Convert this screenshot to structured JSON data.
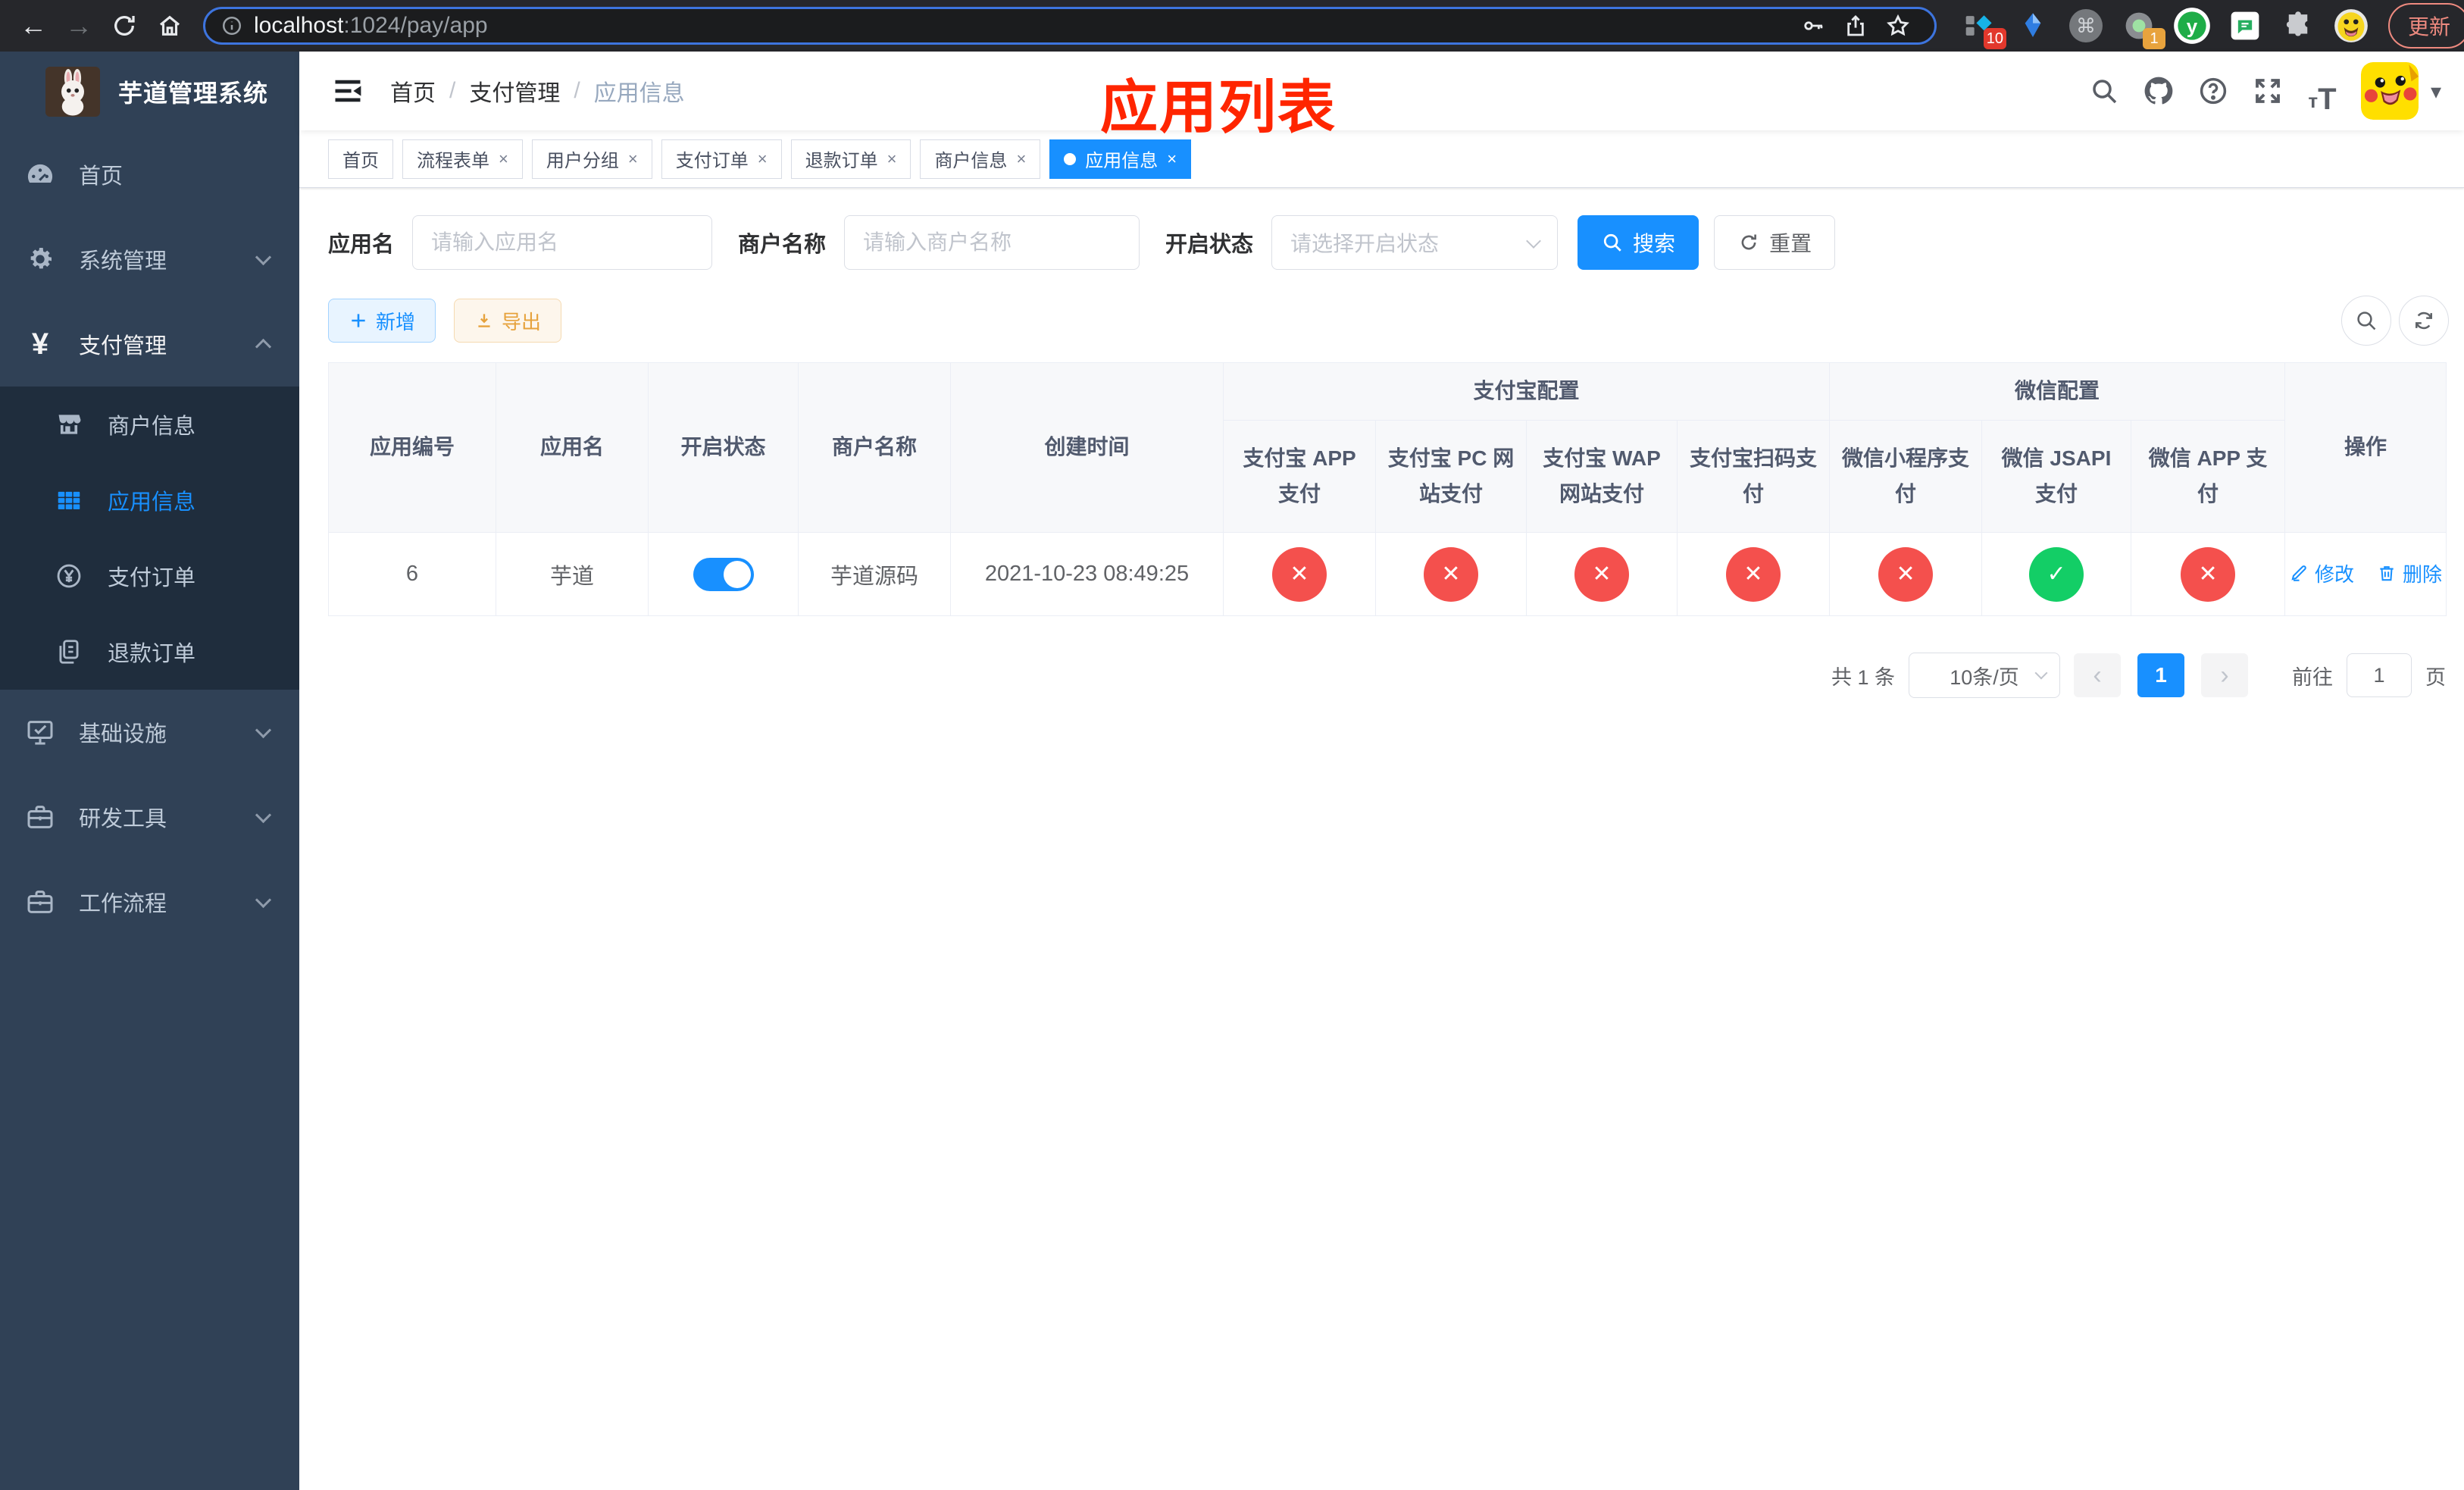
{
  "glyphs": {
    "back": "←",
    "forward": "→",
    "close": "×",
    "check": "✓",
    "cross": "✕",
    "dot": "",
    "caret": "▾",
    "kebab": "⋮",
    "cmd": "⌘",
    "prev": "‹",
    "next": "›",
    "plus": "＋",
    "ext_y": "y"
  },
  "colors": {
    "primary": "#1890ff",
    "danger": "#f4504d",
    "success": "#13ce66",
    "warning": "#e6a23c",
    "annotation_red": "#ff2500",
    "sidebar_bg": "#304156",
    "submenu_bg": "#1f2d3d"
  },
  "browser": {
    "url_host": "localhost",
    "url_rest": ":1024/pay/app",
    "ext_badge_pinned": "10",
    "ext_badge_recorder": "1",
    "update_label": "更新"
  },
  "sidebar": {
    "title": "芋道管理系统",
    "items": [
      {
        "label": "首页"
      },
      {
        "label": "系统管理"
      },
      {
        "label": "支付管理"
      },
      {
        "label": "基础设施"
      },
      {
        "label": "研发工具"
      },
      {
        "label": "工作流程"
      }
    ],
    "subitems": [
      {
        "label": "商户信息"
      },
      {
        "label": "应用信息"
      },
      {
        "label": "支付订单"
      },
      {
        "label": "退款订单"
      }
    ]
  },
  "header": {
    "breadcrumb": [
      "首页",
      "支付管理",
      "应用信息"
    ],
    "annotation": "应用列表"
  },
  "tabs": [
    {
      "label": "首页"
    },
    {
      "label": "流程表单"
    },
    {
      "label": "用户分组"
    },
    {
      "label": "支付订单"
    },
    {
      "label": "退款订单"
    },
    {
      "label": "商户信息"
    },
    {
      "label": "应用信息"
    }
  ],
  "filters": {
    "app_name_label": "应用名",
    "app_name_placeholder": "请输入应用名",
    "merchant_label": "商户名称",
    "merchant_placeholder": "请输入商户名称",
    "status_label": "开启状态",
    "status_placeholder": "请选择开启状态",
    "search_label": "搜索",
    "reset_label": "重置"
  },
  "toolbar": {
    "add_label": "新增",
    "export_label": "导出"
  },
  "table": {
    "headers_main": [
      "应用编号",
      "应用名",
      "开启状态",
      "商户名称",
      "创建时间"
    ],
    "groups": [
      {
        "label": "支付宝配置",
        "cols": [
          "支付宝 APP 支付",
          "支付宝 PC 网站支付",
          "支付宝 WAP 网站支付",
          "支付宝扫码支付"
        ]
      },
      {
        "label": "微信配置",
        "cols": [
          "微信小程序支付",
          "微信 JSAPI 支付",
          "微信 APP 支付"
        ]
      }
    ],
    "action_header": "操作",
    "row": {
      "id": "6",
      "name": "芋道",
      "enabled": true,
      "merchant": "芋道源码",
      "created": "2021-10-23 08:49:25",
      "statuses": [
        "fail",
        "fail",
        "fail",
        "fail",
        "fail",
        "ok",
        "fail"
      ],
      "edit_label": "修改",
      "delete_label": "删除"
    }
  },
  "pagination": {
    "total": "共 1 条",
    "page_size": "10条/页",
    "current_page": "1",
    "goto_label": "前往",
    "goto_value": "1",
    "page_unit": "页"
  }
}
